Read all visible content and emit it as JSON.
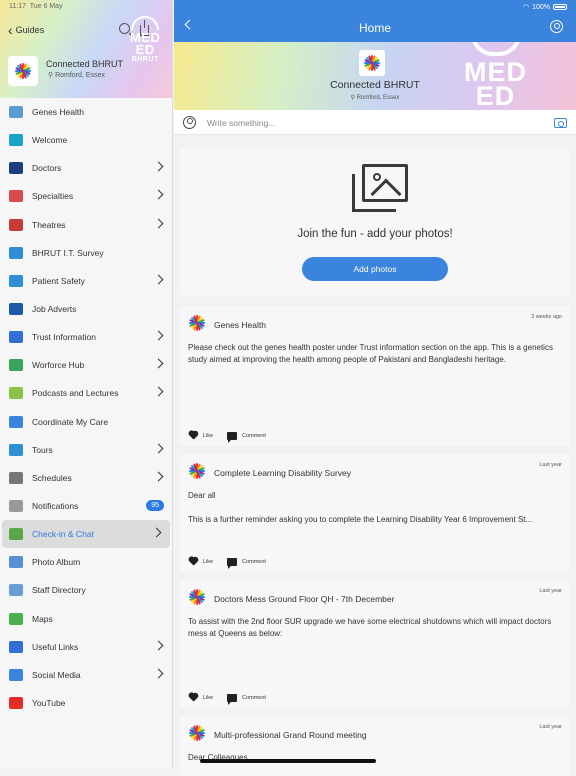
{
  "status": {
    "time": "11:17",
    "date": "Tue 6 May",
    "battery": "100%"
  },
  "sidebar": {
    "back_label": "Guides",
    "org_name": "Connected BHRUT",
    "org_location": "Romford, Essex",
    "brand_lines": [
      "MED",
      "ED",
      "BHRUT"
    ],
    "items": [
      {
        "label": "Genes Health",
        "icon": "genes-icon",
        "color": "#5a9bd5",
        "arrow": false
      },
      {
        "label": "Welcome",
        "icon": "welcome-icon",
        "color": "#1aa3c9",
        "arrow": false
      },
      {
        "label": "Doctors",
        "icon": "doctors-icon",
        "color": "#1f3f7a",
        "arrow": true
      },
      {
        "label": "Specialties",
        "icon": "specialties-icon",
        "color": "#d94b4b",
        "arrow": true
      },
      {
        "label": "Theatres",
        "icon": "theatres-icon",
        "color": "#c73b3b",
        "arrow": true
      },
      {
        "label": "BHRUT I.T. Survey",
        "icon": "survey-icon",
        "color": "#2f8fd6",
        "arrow": false
      },
      {
        "label": "Patient Safety",
        "icon": "info-icon",
        "color": "#2f8fd6",
        "arrow": true
      },
      {
        "label": "Job Adverts",
        "icon": "jobs-icon",
        "color": "#1d5aa8",
        "arrow": false
      },
      {
        "label": "Trust Information",
        "icon": "trust-icon",
        "color": "#2f6fd6",
        "arrow": true
      },
      {
        "label": "Worforce Hub",
        "icon": "workforce-icon",
        "color": "#3aa55b",
        "arrow": true
      },
      {
        "label": "Podcasts and Lectures",
        "icon": "podcast-icon",
        "color": "#8bc34a",
        "arrow": true
      },
      {
        "label": "Coordinate My Care",
        "icon": "care-icon",
        "color": "#3a84dd",
        "arrow": false
      },
      {
        "label": "Tours",
        "icon": "tours-icon",
        "color": "#2f8fd6",
        "arrow": true
      },
      {
        "label": "Schedules",
        "icon": "schedules-icon",
        "color": "#777777",
        "arrow": true
      },
      {
        "label": "Notifications",
        "icon": "mail-icon",
        "color": "#999999",
        "arrow": false,
        "badge": "95"
      },
      {
        "label": "Check-in & Chat",
        "icon": "map-heart-icon",
        "color": "#5aa64a",
        "arrow": true,
        "active": true
      },
      {
        "label": "Photo Album",
        "icon": "photo-icon",
        "color": "#5a8fd6",
        "arrow": false
      },
      {
        "label": "Staff Directory",
        "icon": "directory-icon",
        "color": "#6a9ed6",
        "arrow": false
      },
      {
        "label": "Maps",
        "icon": "maps-icon",
        "color": "#4caf50",
        "arrow": false
      },
      {
        "label": "Useful Links",
        "icon": "globe-icon",
        "color": "#2f6fd6",
        "arrow": true
      },
      {
        "label": "Social Media",
        "icon": "social-icon",
        "color": "#3a84dd",
        "arrow": true
      },
      {
        "label": "YouTube",
        "icon": "youtube-icon",
        "color": "#e52d27",
        "arrow": false
      }
    ]
  },
  "main": {
    "title": "Home",
    "org_name": "Connected BHRUT",
    "org_location": "Romford, Essex",
    "brand_lines": [
      "MED",
      "ED"
    ],
    "composer_placeholder": "Write something...",
    "photo_prompt": "Join the fun - add your photos!",
    "add_photos": "Add photos",
    "like_label": "Like",
    "comment_label": "Comment",
    "posts": [
      {
        "title": "Genes Health",
        "time": "3 weeks ago",
        "paragraphs": [
          "Please check out the genes health poster under Trust information section on the app. This is a genetics study aimed at improving the health among people of Pakistani and Bangladeshi heritage."
        ]
      },
      {
        "title": "Complete Learning Disability Survey",
        "time": "Last year",
        "paragraphs": [
          "Dear all",
          "This is a further reminder asking you to complete the Learning Disability Year 6 Improvement St..."
        ]
      },
      {
        "title": "Doctors Mess Ground Floor QH - 7th December",
        "time": "Last year",
        "paragraphs": [
          "To assist with the 2nd floor SUR upgrade we have some electrical shutdowns which will impact doctors mess at Queens as below:"
        ]
      },
      {
        "title": "Multi-professional Grand Round meeting",
        "time": "Last year",
        "paragraphs": [
          "Dear Colleagues,"
        ]
      }
    ]
  },
  "colors": {
    "accent": "#3a84dd",
    "active_text": "#2c7be5"
  }
}
